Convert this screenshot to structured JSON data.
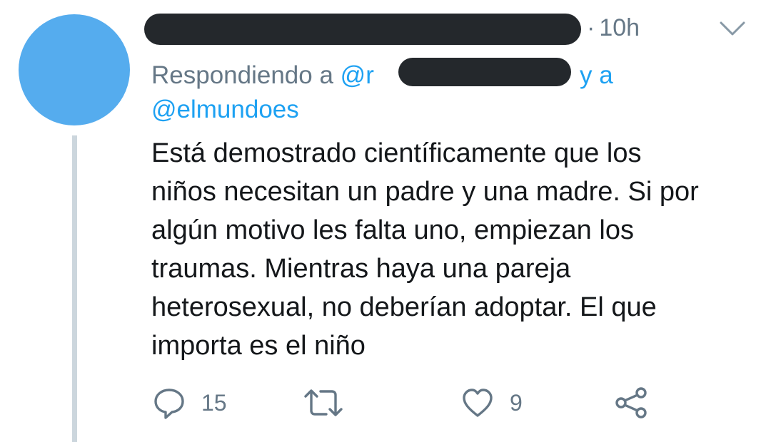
{
  "tweet": {
    "time_separator": "·",
    "time": "10h",
    "reply_prefix": "Respondiendo a",
    "reply_mention_partial": "@r",
    "reply_connector": "y a",
    "reply_mention_2": "@elmundoes",
    "text_lines": [
      "Está demostrado científicamente que los",
      "niños necesitan un padre y una madre. Si por",
      "algún motivo les falta uno, empiezan los",
      "traumas. Mientras haya una pareja",
      "heterosexual, no deberían adoptar. El que",
      "importa es el niño"
    ],
    "actions": {
      "reply_count": "15",
      "retweet_count": "",
      "like_count": "9"
    }
  },
  "icons": {
    "menu": "chevron-down-icon",
    "reply": "reply-bubble-icon",
    "retweet": "retweet-icon",
    "like": "heart-icon",
    "share": "share-icon"
  },
  "colors": {
    "avatar": "#55acee",
    "link": "#1da1f2",
    "secondary_text": "#657786",
    "primary_text": "#14171a",
    "thread_line": "#ccd6dd"
  }
}
